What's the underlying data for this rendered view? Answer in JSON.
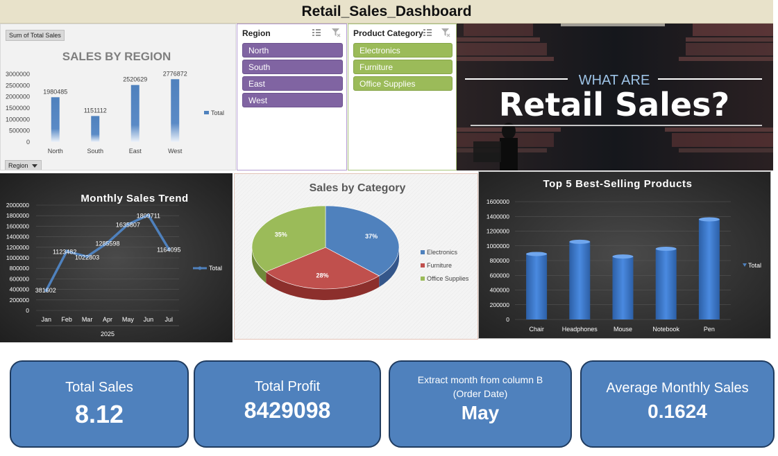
{
  "dashboard": {
    "title": "Retail_Sales_Dashboard"
  },
  "region_chart": {
    "field_button": "Sum of Total Sales",
    "filter_button": "Region",
    "legend": "Total",
    "chart_data": {
      "type": "bar",
      "title": "SALES BY REGION",
      "categories": [
        "North",
        "South",
        "East",
        "West"
      ],
      "values": [
        1980485,
        1151112,
        2520629,
        2776872
      ],
      "yticks": [
        "3000000",
        "2500000",
        "2000000",
        "1500000",
        "1000000",
        "500000",
        "0"
      ],
      "ylim": [
        0,
        3000000
      ],
      "data_labels": [
        "1980485",
        "1151112",
        "2520629",
        "2776872"
      ],
      "legend_position": "right",
      "color": "#4f81bd"
    }
  },
  "slicer_region": {
    "header": "Region",
    "items": [
      "North",
      "South",
      "East",
      "West"
    ],
    "color": "#8064a2"
  },
  "slicer_category": {
    "header": "Product Category",
    "items": [
      "Electronics",
      "Furniture",
      "Office Supplies"
    ],
    "color": "#9bbb59"
  },
  "banner": {
    "line1": "WHAT ARE",
    "line2": "Retail Sales?"
  },
  "trend_chart": {
    "legend": "Total",
    "chart_data": {
      "type": "line",
      "title": "Monthly Sales Trend",
      "categories": [
        "Jan",
        "Feb",
        "Mar",
        "Apr",
        "May",
        "Jun",
        "Jul"
      ],
      "values": [
        381602,
        1123482,
        1022803,
        1285598,
        1635807,
        1809711,
        1164095
      ],
      "data_labels": [
        "381602",
        "1123482",
        "1022803",
        "1285598",
        "1635807",
        "1809711",
        "1164095"
      ],
      "yticks": [
        "2000000",
        "1800000",
        "1600000",
        "1400000",
        "1200000",
        "1000000",
        "800000",
        "600000",
        "400000",
        "200000",
        "0"
      ],
      "ylim": [
        0,
        2000000
      ],
      "group_label": "2025",
      "legend_position": "right",
      "color": "#4f81bd"
    }
  },
  "pie_chart": {
    "chart_data": {
      "type": "pie",
      "title": "Sales by Category",
      "labels": [
        "Electronics",
        "Furniture",
        "Office Supplies"
      ],
      "values": [
        37,
        28,
        35
      ],
      "data_labels": [
        "37%",
        "28%",
        "35%"
      ],
      "colors": [
        "#4f81bd",
        "#c0504d",
        "#9bbb59"
      ],
      "legend_position": "right"
    }
  },
  "top5_chart": {
    "legend": "Total",
    "chart_data": {
      "type": "bar",
      "title": "Top 5 Best-Selling Products",
      "categories": [
        "Chair",
        "Headphones",
        "Mouse",
        "Notebook",
        "Pen"
      ],
      "values": [
        890000,
        1055000,
        855000,
        960000,
        1360000
      ],
      "yticks": [
        "1600000",
        "1400000",
        "1200000",
        "1000000",
        "800000",
        "600000",
        "400000",
        "200000",
        "0"
      ],
      "ylim": [
        0,
        1600000
      ],
      "legend_position": "right",
      "color": "#3a75c4"
    }
  },
  "kpis": [
    {
      "label": "Total Sales",
      "value": "8.12"
    },
    {
      "label": "Total Profit",
      "value": "8429098"
    },
    {
      "label": "Extract month from column B (Order Date)",
      "value": "May"
    },
    {
      "label": "Average Monthly Sales",
      "value": "0.1624"
    }
  ]
}
